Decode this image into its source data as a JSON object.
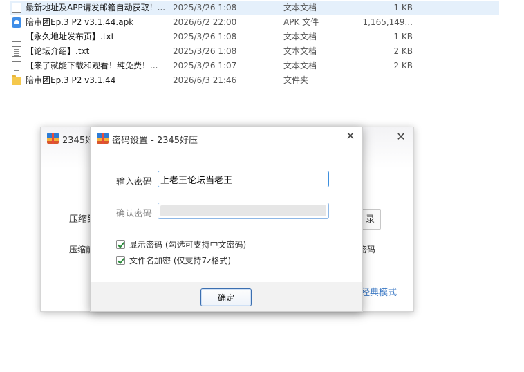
{
  "files": [
    {
      "name": "最新地址及APP请发邮箱自动获取！...",
      "date": "2025/3/26 1:08",
      "type": "文本文档",
      "size": "1 KB",
      "icon": "text-file-icon",
      "selected": true
    },
    {
      "name": "陪审团Ep.3 P2 v3.1.44.apk",
      "date": "2026/6/2 22:00",
      "type": "APK 文件",
      "size": "1,165,149...",
      "icon": "apk-file-icon",
      "selected": false
    },
    {
      "name": "【永久地址发布页】.txt",
      "date": "2025/3/26 1:08",
      "type": "文本文档",
      "size": "1 KB",
      "icon": "text-file-icon",
      "selected": false
    },
    {
      "name": "【论坛介绍】.txt",
      "date": "2025/3/26 1:08",
      "type": "文本文档",
      "size": "2 KB",
      "icon": "text-file-icon",
      "selected": false
    },
    {
      "name": "【来了就能下载和观看！纯免费！...",
      "date": "2025/3/26 1:07",
      "type": "文本文档",
      "size": "2 KB",
      "icon": "text-file-icon",
      "selected": false
    },
    {
      "name": "陪审团Ep.3 P2 v3.1.44",
      "date": "2026/6/3 21:46",
      "type": "文件夹",
      "size": "",
      "icon": "folder-icon",
      "selected": false
    }
  ],
  "bg_window": {
    "title": "2345好",
    "label_compress_to": "压缩到",
    "label_compress_name": "压缩前",
    "browse_button": "录",
    "right_text": "密码",
    "classic_mode_link": "经典模式"
  },
  "dialog": {
    "title": "密码设置 - 2345好压",
    "password_label": "输入密码",
    "password_value": "上老王论坛当老王",
    "confirm_label": "确认密码",
    "confirm_value": "",
    "show_password_label": "显示密码 (勾选可支持中文密码)",
    "show_password_checked": true,
    "encrypt_names_label": "文件名加密 (仅支持7z格式)",
    "encrypt_names_checked": true,
    "ok_button": "确定"
  },
  "colors": {
    "selection": "#e5f0fb",
    "link": "#3b78c4",
    "input_border": "#3d8fde",
    "check": "#2a8a3a"
  }
}
